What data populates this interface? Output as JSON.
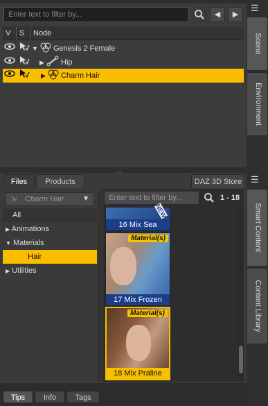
{
  "scene": {
    "filter_placeholder": "Enter text to filter by...",
    "columns": {
      "v": "V",
      "s": "S",
      "node": "Node"
    },
    "nodes": [
      {
        "label": "Genesis 2 Female"
      },
      {
        "label": "Hip"
      },
      {
        "label": "Charm Hair"
      }
    ],
    "side_tabs": [
      "Scene",
      "Environment"
    ]
  },
  "library": {
    "tabs": [
      "Files",
      "Products",
      "DAZ 3D Store"
    ],
    "combo_value": "Charm Hair",
    "filter_placeholder": "Enter text to filter by...",
    "page_range": "1 - 18",
    "tree": {
      "all": "All",
      "animations": "Animations",
      "materials": "Materials",
      "hair": "Hair",
      "utilities": "Utilities"
    },
    "thumbs": [
      {
        "label": "16 Mix Sea"
      },
      {
        "label": "17 Mix Frozen",
        "badge": "Material(s)"
      },
      {
        "label": "18 Mix Praline",
        "badge": "Material(s)"
      }
    ],
    "side_tabs": [
      "Smart Content",
      "Content Library"
    ]
  },
  "bottom_tabs": [
    "Tips",
    "Info",
    "Tags"
  ],
  "colors": {
    "selection": "#fbbd00",
    "caption_blue": "#1a3f88"
  }
}
